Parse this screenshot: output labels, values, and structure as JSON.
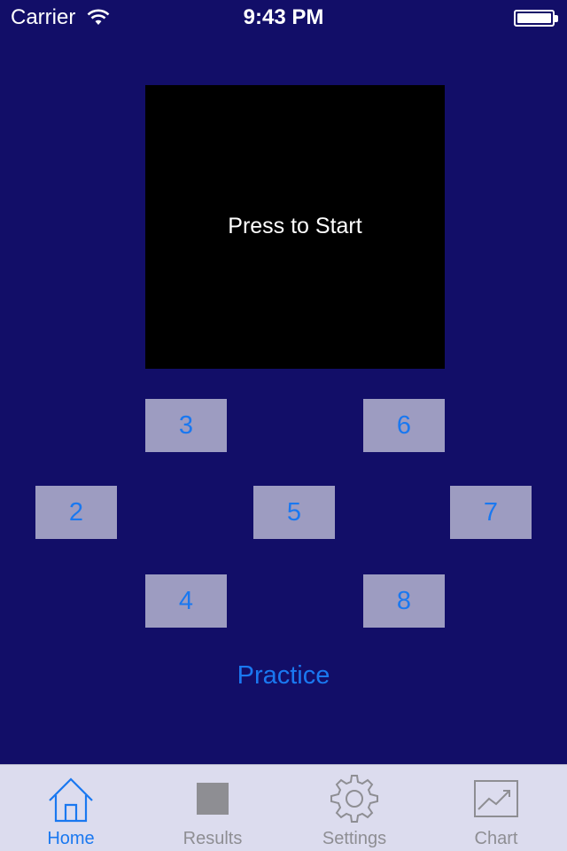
{
  "status_bar": {
    "carrier": "Carrier",
    "time": "9:43 PM",
    "icons": [
      "wifi-icon",
      "battery-icon"
    ]
  },
  "start_panel": {
    "label": "Press to Start"
  },
  "keys": {
    "k3": "3",
    "k6": "6",
    "k2": "2",
    "k5": "5",
    "k7": "7",
    "k4": "4",
    "k8": "8"
  },
  "practice": {
    "label": "Practice"
  },
  "tab_bar": {
    "tabs": [
      {
        "label": "Home",
        "icon": "home-icon",
        "active": true
      },
      {
        "label": "Results",
        "icon": "results-icon",
        "active": false
      },
      {
        "label": "Settings",
        "icon": "gear-icon",
        "active": false
      },
      {
        "label": "Chart",
        "icon": "chart-icon",
        "active": false
      }
    ]
  },
  "colors": {
    "background": "#120e68",
    "accent": "#1a78f0",
    "key_fill": "#9d9cc1",
    "tab_bar": "#dcdcee",
    "inactive_tab": "#8e8e93"
  }
}
